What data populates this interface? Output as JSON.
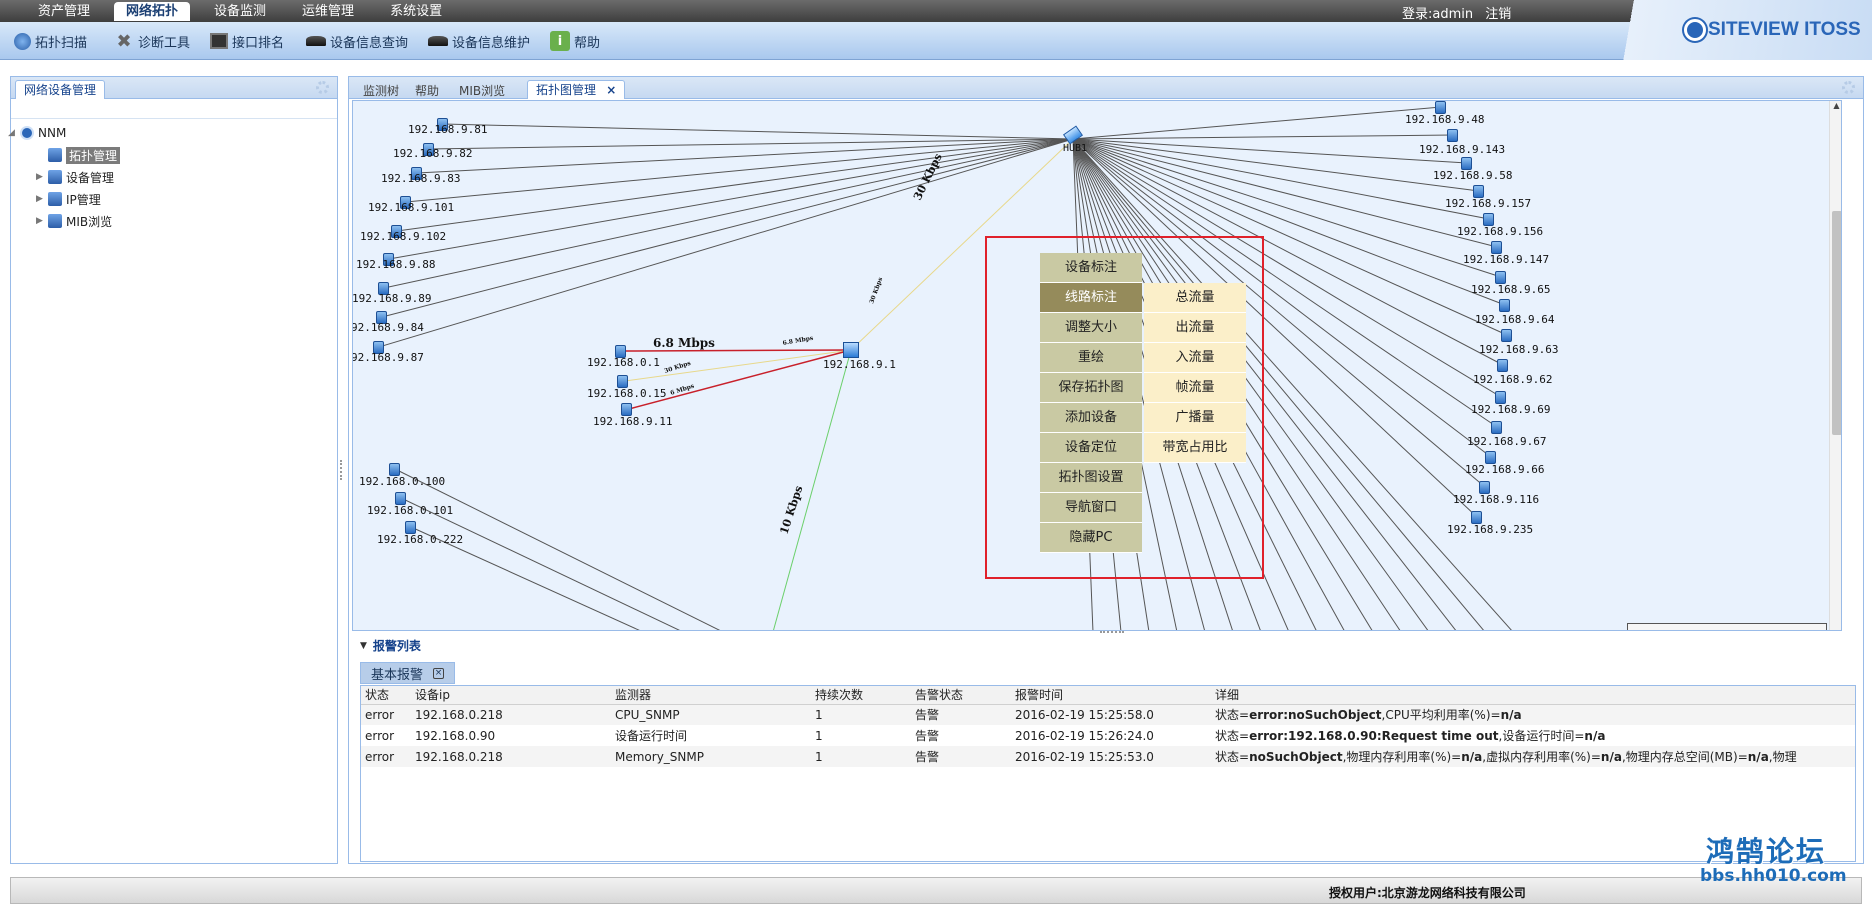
{
  "nav": {
    "tabs": [
      "资产管理",
      "网络拓扑",
      "设备监测",
      "运维管理",
      "系统设置"
    ],
    "active_tab": "网络拓扑",
    "login_label": "登录:admin",
    "logout_label": "注销"
  },
  "brand": {
    "name": "SITEVIEW ITOSS"
  },
  "toolbar": {
    "items": [
      {
        "label": "拓扑扫描",
        "icon": "globe-scan-icon"
      },
      {
        "label": "诊断工具",
        "icon": "wrench-tools-icon"
      },
      {
        "label": "接口排名",
        "icon": "monitor-icon"
      },
      {
        "label": "设备信息查询",
        "icon": "device-search-icon"
      },
      {
        "label": "设备信息维护",
        "icon": "device-maintain-icon"
      },
      {
        "label": "帮助",
        "icon": "info-icon"
      }
    ]
  },
  "left_panel": {
    "title": "网络设备管理",
    "tree": {
      "root": "NNM",
      "children": [
        {
          "label": "拓扑管理",
          "selected": true,
          "expandable": false
        },
        {
          "label": "设备管理",
          "selected": false,
          "expandable": true
        },
        {
          "label": "IP管理",
          "selected": false,
          "expandable": true
        },
        {
          "label": "MIB浏览",
          "selected": false,
          "expandable": true
        }
      ]
    }
  },
  "content_tabs": [
    "监测树",
    "帮助",
    "MIB浏览",
    "拓扑图管理"
  ],
  "active_content_tab": "拓扑图管理",
  "topology": {
    "hub_label": "HUB1",
    "core_switch": "192.168.9.1",
    "left_nodes": [
      "192.168.9.81",
      "192.168.9.82",
      "192.168.9.83",
      "192.168.9.101",
      "192.168.9.102",
      "192.168.9.88",
      "192.168.9.89",
      "92.168.9.84",
      "92.168.9.87"
    ],
    "right_nodes": [
      "192.168.9.48",
      "192.168.9.143",
      "192.168.9.58",
      "192.168.9.157",
      "192.168.9.156",
      "192.168.9.147",
      "192.168.9.65",
      "192.168.9.64",
      "192.168.9.63",
      "192.168.9.62",
      "192.168.9.69",
      "192.168.9.67",
      "192.168.9.66",
      "192.168.9.116",
      "192.168.9.235"
    ],
    "mid_nodes": [
      "192.168.0.1",
      "192.168.0.15",
      "192.168.9.11"
    ],
    "bottom_nodes": [
      "192.168.0.100",
      "192.168.0.101",
      "192.168.0.222"
    ],
    "link_labels": {
      "hub_link": "30 Kbps",
      "red_link": "6.8 Mbps",
      "bottom_link": "10 Kbps",
      "small_a": "30 Kbps",
      "small_b": "6 Mbps",
      "small_c": "6.8 Mbps",
      "small_d": "30 Kbps"
    }
  },
  "context_menu": {
    "items": [
      "设备标注",
      "线路标注",
      "调整大小",
      "重绘",
      "保存拓扑图",
      "添加设备",
      "设备定位",
      "拓扑图设置",
      "导航窗口",
      "隐藏PC"
    ],
    "highlighted": "线路标注",
    "submenu": [
      "总流量",
      "出流量",
      "入流量",
      "帧流量",
      "广播量",
      "带宽占用比"
    ]
  },
  "alarm": {
    "section_title": "报警列表",
    "tab_label": "基本报警",
    "columns": [
      "状态",
      "设备ip",
      "监测器",
      "持续次数",
      "告警状态",
      "报警时间",
      "详细"
    ],
    "rows": [
      {
        "status": "error",
        "ip": "192.168.0.218",
        "monitor": "CPU_SNMP",
        "count": "1",
        "alarm": "告警",
        "time": "2016-02-19 15:25:58.0",
        "detail_html": "状态=<b>error:noSuchObject</b>,CPU平均利用率(%)=<b>n/a</b>"
      },
      {
        "status": "error",
        "ip": "192.168.0.90",
        "monitor": "设备运行时间",
        "count": "1",
        "alarm": "告警",
        "time": "2016-02-19 15:26:24.0",
        "detail_html": "状态=<b>error:192.168.0.90:Request time out</b>,设备运行时间=<b>n/a</b>"
      },
      {
        "status": "error",
        "ip": "192.168.0.218",
        "monitor": "Memory_SNMP",
        "count": "1",
        "alarm": "告警",
        "time": "2016-02-19 15:25:53.0",
        "detail_html": "状态=<b>noSuchObject</b>,物理内存利用率(%)=<b>n/a</b>,虚拟内存利用率(%)=<b>n/a</b>,物理内存总空间(MB)=<b>n/a</b>,物理"
      }
    ]
  },
  "footer": {
    "text": "授权用户:北京游龙网络科技有限公司"
  },
  "watermark": {
    "title": "鸿鹄论坛",
    "url": "bbs.hh010.com"
  },
  "colors": {
    "accent": "#2a66b8",
    "alert_box": "#e0212b",
    "menu_bg": "#c9c9a3",
    "menu_highlight": "#958b5b",
    "submenu_bg": "#fbefc9"
  }
}
